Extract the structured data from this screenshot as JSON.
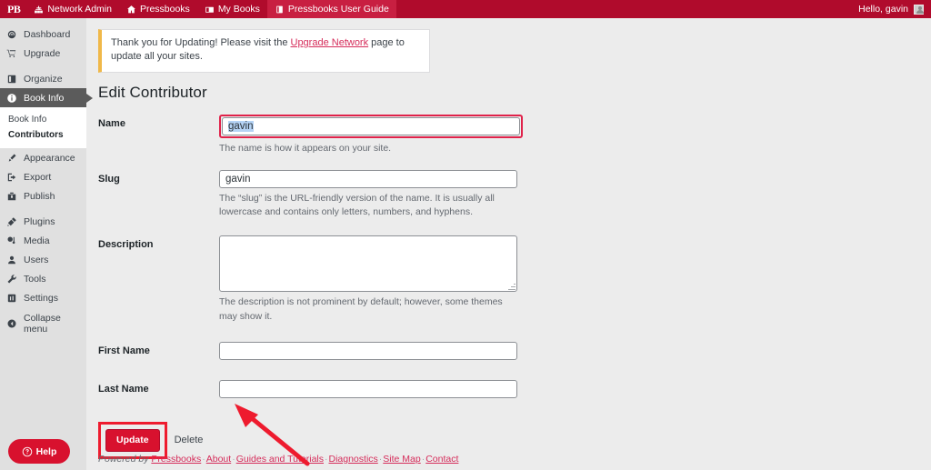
{
  "adminbar": {
    "logo": "PB",
    "logo_icon": "pressbooks-logo-icon",
    "items": [
      {
        "label": "Network Admin",
        "icon": "network-icon",
        "highlight": false
      },
      {
        "label": "Pressbooks",
        "icon": "home-icon",
        "highlight": false
      },
      {
        "label": "My Books",
        "icon": "books-icon",
        "highlight": false
      },
      {
        "label": "Pressbooks User Guide",
        "icon": "book-icon",
        "highlight": true
      }
    ],
    "greeting": "Hello, gavin",
    "avatar_icon": "avatar-icon"
  },
  "sidebar": {
    "items": [
      {
        "label": "Dashboard",
        "icon": "dashboard-icon",
        "current": false,
        "sep_after": false
      },
      {
        "label": "Upgrade",
        "icon": "cart-icon",
        "current": false,
        "sep_after": true
      },
      {
        "label": "Organize",
        "icon": "organize-icon",
        "current": false,
        "sep_after": false
      },
      {
        "label": "Book Info",
        "icon": "info-icon",
        "current": true,
        "sep_after": false
      },
      {
        "label": "Appearance",
        "icon": "appearance-icon",
        "current": false,
        "sep_after": false
      },
      {
        "label": "Export",
        "icon": "export-icon",
        "current": false,
        "sep_after": false
      },
      {
        "label": "Publish",
        "icon": "publish-icon",
        "current": false,
        "sep_after": true
      },
      {
        "label": "Plugins",
        "icon": "plugins-icon",
        "current": false,
        "sep_after": false
      },
      {
        "label": "Media",
        "icon": "media-icon",
        "current": false,
        "sep_after": false
      },
      {
        "label": "Users",
        "icon": "users-icon",
        "current": false,
        "sep_after": false
      },
      {
        "label": "Tools",
        "icon": "tools-icon",
        "current": false,
        "sep_after": false
      },
      {
        "label": "Settings",
        "icon": "settings-icon",
        "current": false,
        "sep_after": true
      },
      {
        "label": "Collapse menu",
        "icon": "collapse-icon",
        "current": false,
        "sep_after": false
      }
    ],
    "submenu": [
      {
        "label": "Book Info",
        "current": false
      },
      {
        "label": "Contributors",
        "current": true
      }
    ]
  },
  "help_button": {
    "label": "Help",
    "icon": "question-circle-icon"
  },
  "notice": {
    "text_before": "Thank you for Updating! Please visit the ",
    "link": "Upgrade Network",
    "text_after": " page to update all your sites.",
    "accent_color": "#f0b849"
  },
  "page": {
    "title": "Edit Contributor"
  },
  "form": {
    "name": {
      "label": "Name",
      "value": "gavin",
      "selected": true,
      "description": "The name is how it appears on your site.",
      "highlight_color": "#e0224a"
    },
    "slug": {
      "label": "Slug",
      "value": "gavin",
      "placeholder": "",
      "description": "The “slug” is the URL-friendly version of the name. It is usually all lowercase and contains only letters, numbers, and hyphens."
    },
    "description": {
      "label": "Description",
      "value": "",
      "placeholder": "",
      "description": "The description is not prominent by default; however, some themes may show it."
    },
    "first_name": {
      "label": "First Name",
      "value": "",
      "placeholder": ""
    },
    "last_name": {
      "label": "Last Name",
      "value": "",
      "placeholder": ""
    }
  },
  "actions": {
    "update_label": "Update",
    "delete_label": "Delete",
    "update_color": "#d8112e",
    "annotation_color": "#ee1b2e"
  },
  "annotation": {
    "arrow_color": "#ee1b2e",
    "points_to": "update-button"
  },
  "footer": {
    "prefix": "Powered by",
    "links": [
      "Pressbooks",
      "About",
      "Guides and Tutorials",
      "Diagnostics",
      "Site Map",
      "Contact"
    ],
    "separator": "·"
  }
}
